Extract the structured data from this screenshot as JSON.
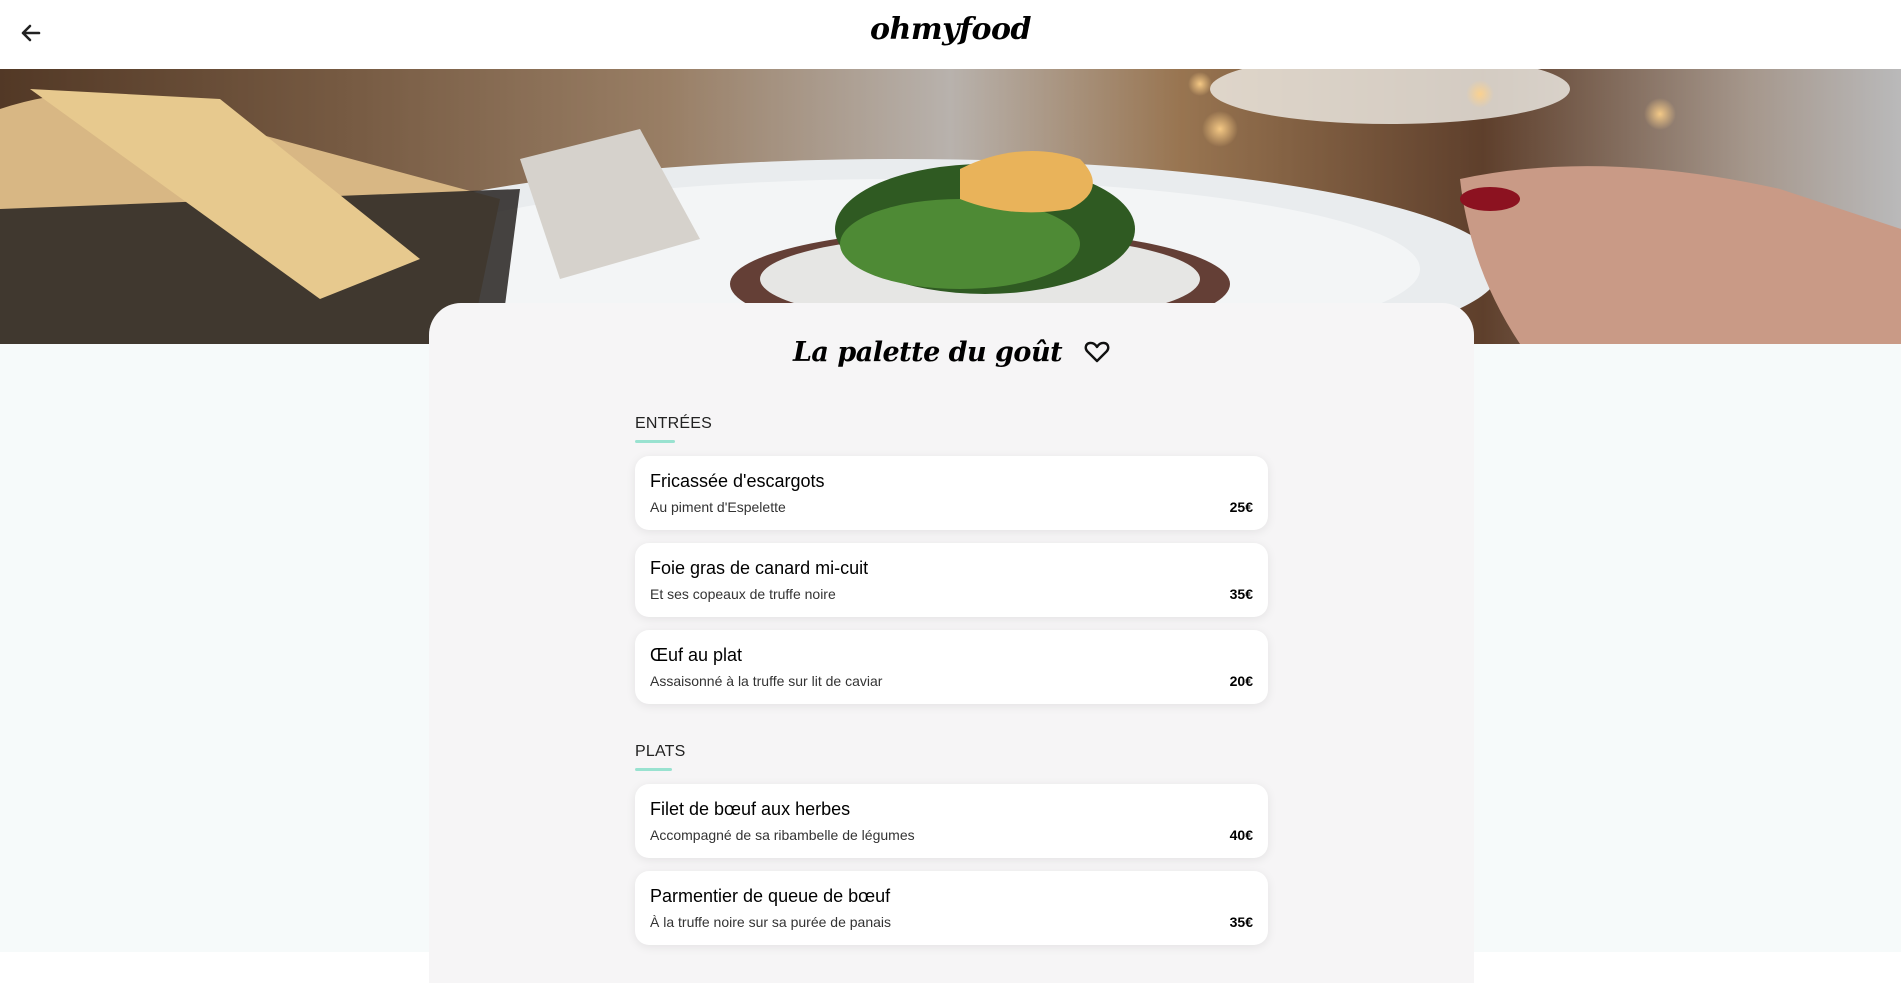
{
  "header": {
    "logo": "ohmyfood",
    "back_icon": "arrow-left-icon"
  },
  "hero": {
    "image": "restaurant-dish-photo"
  },
  "restaurant": {
    "name": "La palette du goût",
    "favorite_icon": "heart-outline-icon"
  },
  "menu": {
    "sections": [
      {
        "title": "ENTRÉES",
        "dishes": [
          {
            "name": "Fricassée d'escargots",
            "desc": "Au piment d'Espelette",
            "price": "25€"
          },
          {
            "name": "Foie gras de canard mi-cuit",
            "desc": "Et ses copeaux de truffe noire",
            "price": "35€"
          },
          {
            "name": "Œuf au plat",
            "desc": "Assaisonné à la truffe sur lit de caviar",
            "price": "20€"
          }
        ]
      },
      {
        "title": "PLATS",
        "dishes": [
          {
            "name": "Filet de bœuf aux herbes",
            "desc": "Accompagné de sa ribambelle de légumes",
            "price": "40€"
          },
          {
            "name": "Parmentier de queue de bœuf",
            "desc": "À la truffe noire sur sa purée de panais",
            "price": "35€"
          }
        ]
      }
    ]
  },
  "colors": {
    "accent": "#99e2d0",
    "card_bg": "#f6f5f6",
    "page_bg": "#f6fafa"
  }
}
